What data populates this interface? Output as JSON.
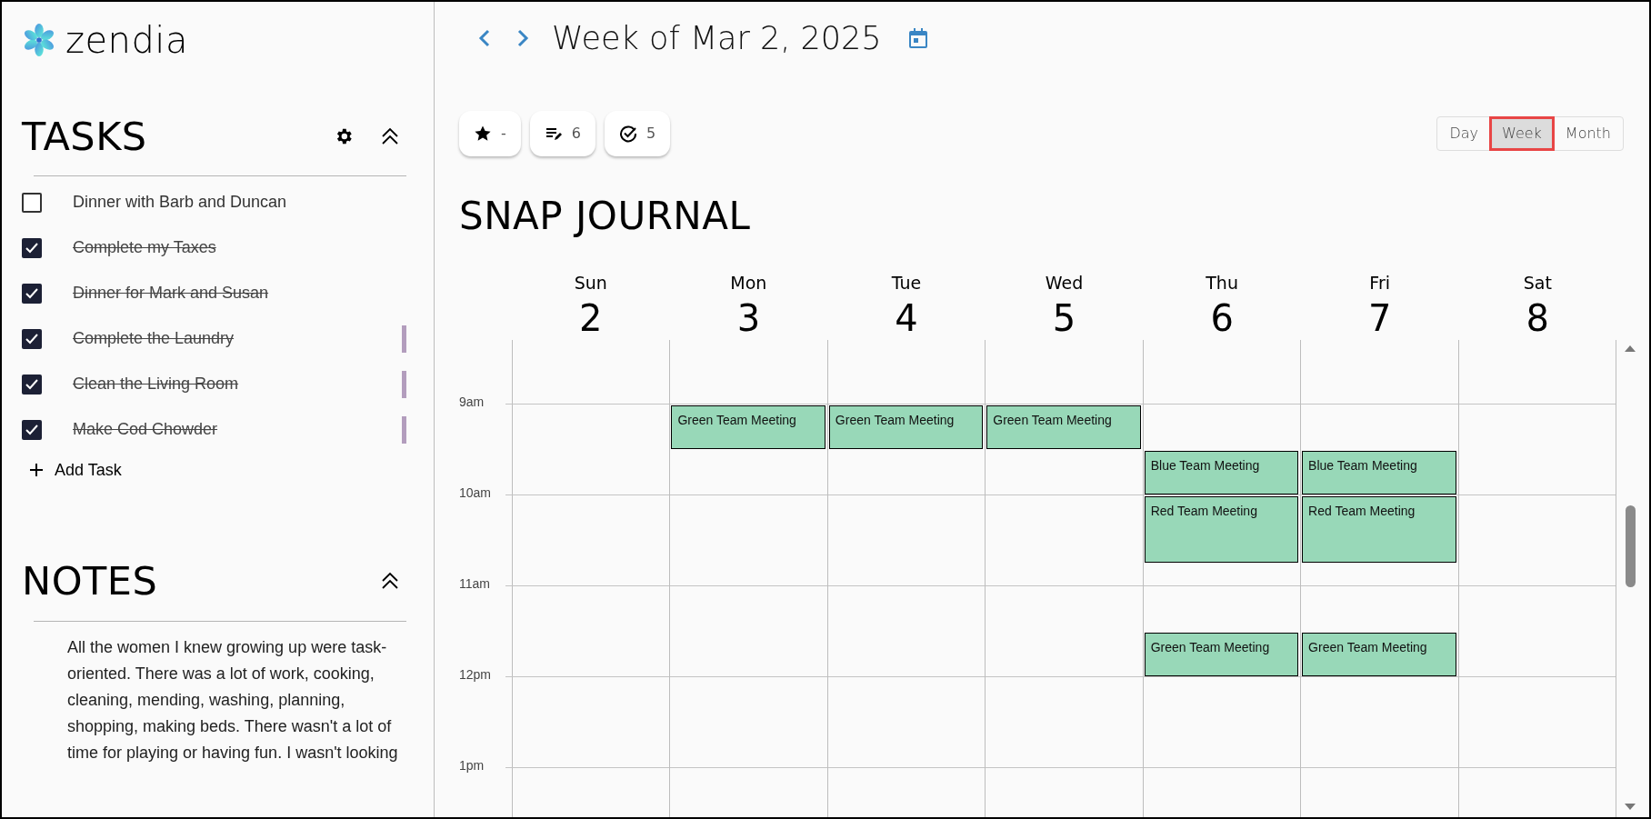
{
  "app": {
    "name": "zendia"
  },
  "tasks": {
    "title": "TASKS",
    "items": [
      {
        "text": "Dinner with Barb and Duncan",
        "checked": false,
        "flagged": false
      },
      {
        "text": "Complete my Taxes",
        "checked": true,
        "flagged": false
      },
      {
        "text": "Dinner for Mark and Susan",
        "checked": true,
        "flagged": false
      },
      {
        "text": "Complete the Laundry",
        "checked": true,
        "flagged": true
      },
      {
        "text": "Clean the Living Room",
        "checked": true,
        "flagged": true
      },
      {
        "text": "Make Cod Chowder",
        "checked": true,
        "flagged": true
      }
    ],
    "add_label": "Add Task"
  },
  "notes": {
    "title": "NOTES",
    "text": "All the women I knew growing up were task-oriented. There was a lot of work, cooking, cleaning, mending, washing, planning, shopping, making beds. There wasn't a lot of time for playing or having fun. I wasn't looking"
  },
  "header": {
    "title": "Week of Mar 2, 2025"
  },
  "stats": [
    {
      "kind": "star",
      "value": "-"
    },
    {
      "kind": "entries",
      "value": "6"
    },
    {
      "kind": "done",
      "value": "5"
    }
  ],
  "views": [
    {
      "label": "Day",
      "selected": false
    },
    {
      "label": "Week",
      "selected": true
    },
    {
      "label": "Month",
      "selected": false
    }
  ],
  "journal": {
    "title": "SNAP JOURNAL"
  },
  "calendar": {
    "hours": [
      "9am",
      "10am",
      "11am",
      "12pm",
      "1pm"
    ],
    "days": [
      {
        "name": "Sun",
        "date": "2"
      },
      {
        "name": "Mon",
        "date": "3",
        "slots": [
          {
            "kind": "meeting",
            "title": "Green Team Meeting"
          }
        ]
      },
      {
        "name": "Tue",
        "date": "4",
        "slots": [
          {
            "kind": "meeting",
            "title": "Green Team Meeting"
          }
        ]
      },
      {
        "name": "Wed",
        "date": "5",
        "slots": [
          {
            "kind": "meeting",
            "title": "Green Team Meeting"
          }
        ]
      },
      {
        "name": "Thu",
        "date": "6",
        "slots": [
          {
            "kind": "gap"
          },
          {
            "kind": "gap"
          },
          {
            "kind": "meeting",
            "title": "Blue Team Meeting"
          },
          {
            "kind": "long-meeting",
            "title": "Red Team Meeting"
          },
          {
            "kind": "gap"
          },
          {
            "kind": "gap"
          },
          {
            "kind": "gap"
          },
          {
            "kind": "meeting",
            "title": "Green Team Meeting"
          }
        ]
      },
      {
        "name": "Fri",
        "date": "7",
        "slots": [
          {
            "kind": "gap"
          },
          {
            "kind": "gap"
          },
          {
            "kind": "meeting",
            "title": "Blue Team Meeting"
          },
          {
            "kind": "long-meeting",
            "title": "Red Team Meeting"
          },
          {
            "kind": "gap"
          },
          {
            "kind": "gap"
          },
          {
            "kind": "gap"
          },
          {
            "kind": "meeting",
            "title": "Green Team Meeting"
          }
        ]
      },
      {
        "name": "Sat",
        "date": "8"
      }
    ]
  }
}
